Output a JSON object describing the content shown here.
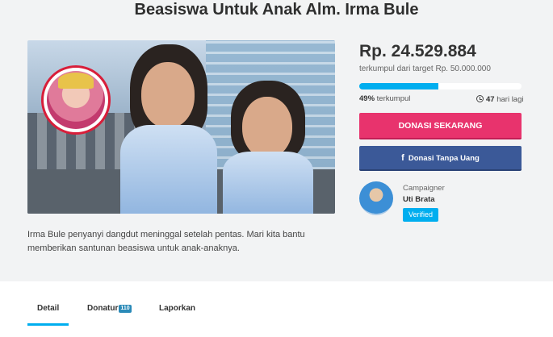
{
  "campaign": {
    "title": "Beasiswa Untuk Anak Alm. Irma Bule",
    "description": "Irma Bule penyanyi dangdut meninggal setelah pentas. Mari kita bantu memberikan santunan beasiswa untuk anak-anaknya."
  },
  "funding": {
    "amount": "Rp. 24.529.884",
    "target_text": "terkumpul dari target Rp. 50.000.000",
    "percent": 49,
    "percent_label": "49%",
    "collected_label": "terkumpul",
    "days_value": "47",
    "days_label": "hari lagi"
  },
  "actions": {
    "donate_label": "DONASI SEKARANG",
    "free_donate_label": "Donasi Tanpa Uang",
    "free_donate_icon": "facebook-icon"
  },
  "campaigner": {
    "label": "Campaigner",
    "name": "Uti Brata",
    "badge": "Verified"
  },
  "tabs": [
    {
      "label": "Detail",
      "active": true
    },
    {
      "label": "Donatur",
      "count": "110"
    },
    {
      "label": "Laporkan"
    }
  ],
  "colors": {
    "accent": "#00aeef",
    "donate": "#e8336d",
    "facebook": "#3b5998"
  }
}
